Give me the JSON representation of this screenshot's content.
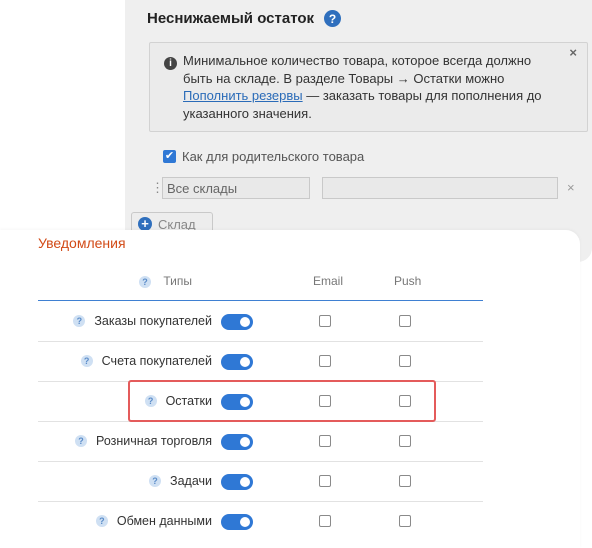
{
  "min_stock": {
    "title": "Неснижаемый остаток",
    "help_symbol": "?",
    "info": {
      "text_before": "Минимальное количество товара, которое всегда должно быть на складе. В разделе Товары → Остатки можно ",
      "link": "Пополнить резервы",
      "text_after": " — заказать товары для пополнения до указанного значения.",
      "close": "×"
    },
    "inherit_label": "Как для родительского товара",
    "warehouse_select": "Все склады",
    "drag_symbol": "⋮",
    "remove_symbol": "×",
    "add_warehouse_label": "Склад"
  },
  "notifications": {
    "title": "Уведомления",
    "columns": {
      "types": "Типы",
      "email": "Email",
      "push": "Push"
    },
    "rows": [
      {
        "label": "Заказы покупателей",
        "enabled": true,
        "email": false,
        "push": false
      },
      {
        "label": "Счета покупателей",
        "enabled": true,
        "email": false,
        "push": false
      },
      {
        "label": "Остатки",
        "enabled": true,
        "email": false,
        "push": false
      },
      {
        "label": "Розничная торговля",
        "enabled": true,
        "email": false,
        "push": false
      },
      {
        "label": "Задачи",
        "enabled": true,
        "email": false,
        "push": false
      },
      {
        "label": "Обмен данными",
        "enabled": true,
        "email": false,
        "push": false
      }
    ],
    "highlighted_row": "Остатки"
  },
  "colors": {
    "accent": "#2f78d5",
    "title_orange": "#d24a16",
    "highlight": "#e45b5b"
  }
}
